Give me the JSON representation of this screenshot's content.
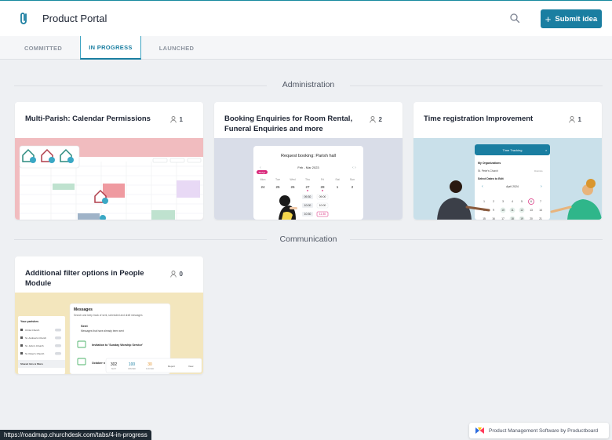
{
  "header": {
    "app_title": "Product Portal",
    "submit_label": "Submit idea",
    "accent": "#1a7ea1"
  },
  "tabs": [
    {
      "label": "COMMITTED",
      "active": false
    },
    {
      "label": "IN PROGRESS",
      "active": true
    },
    {
      "label": "LAUNCHED",
      "active": false
    }
  ],
  "sections": [
    {
      "title": "Administration",
      "cards": [
        {
          "title": "Multi-Parish: Calendar Permissions",
          "votes": "1",
          "image": "calendar-permissions-illustration"
        },
        {
          "title": "Booking Enquiries for Room Rental, Funeral Enquiries and more",
          "votes": "2",
          "image": "booking-enquiry-illustration",
          "booking": {
            "heading": "Request booking: Parish hall",
            "month": "Feb - Mar 2023",
            "badge": "Badge",
            "weekdays": [
              "Mon",
              "Tue",
              "Wed",
              "Thu",
              "Fri",
              "Sat",
              "Sun"
            ],
            "days": [
              "24",
              "25",
              "26",
              "27",
              "28",
              "1",
              "2"
            ],
            "times": [
              "09:30",
              "10:00",
              "10:30"
            ],
            "times_right": [
              "09:00",
              "10:00",
              "11:30"
            ]
          }
        },
        {
          "title": "Time registration Improvement",
          "votes": "1",
          "image": "time-registration-illustration",
          "panel": {
            "heading": "Time Tracking",
            "org_label": "My Organizations",
            "org_name": "St. Peter's Church",
            "org_status": "Districts",
            "dates_label": "Select Dates to Edit",
            "month": "April 2024"
          }
        }
      ]
    },
    {
      "title": "Communication",
      "cards": [
        {
          "title": "Additional filter options in People Module",
          "votes": "0",
          "image": "messages-illustration",
          "parishes": {
            "heading": "Your parishes",
            "items": [
              "Christ Church",
              "St. Andrew's Church",
              "St. John's Church",
              "St. Peter's Church"
            ],
            "footer": "Shared lists & filters"
          },
          "messages": {
            "heading": "Messages",
            "subheading": "Search and keep track of sent, scheduled and draft messages",
            "sent_label": "Sent",
            "sent_sub": "Messages that have already been sent",
            "item1": "Invitation to 'Sunday Worship Service'",
            "item2": "October n",
            "stats": [
              {
                "value": "302",
                "label": "SENT"
              },
              {
                "value": "100",
                "label": "OPENED"
              },
              {
                "value": "30",
                "label": "CLICKED"
              }
            ],
            "report_label": "Report",
            "view_label": "View"
          }
        }
      ]
    }
  ],
  "status_url": "https://roadmap.churchdesk.com/tabs/4-in-progress",
  "powered_by": "Product Management Software by Productboard"
}
